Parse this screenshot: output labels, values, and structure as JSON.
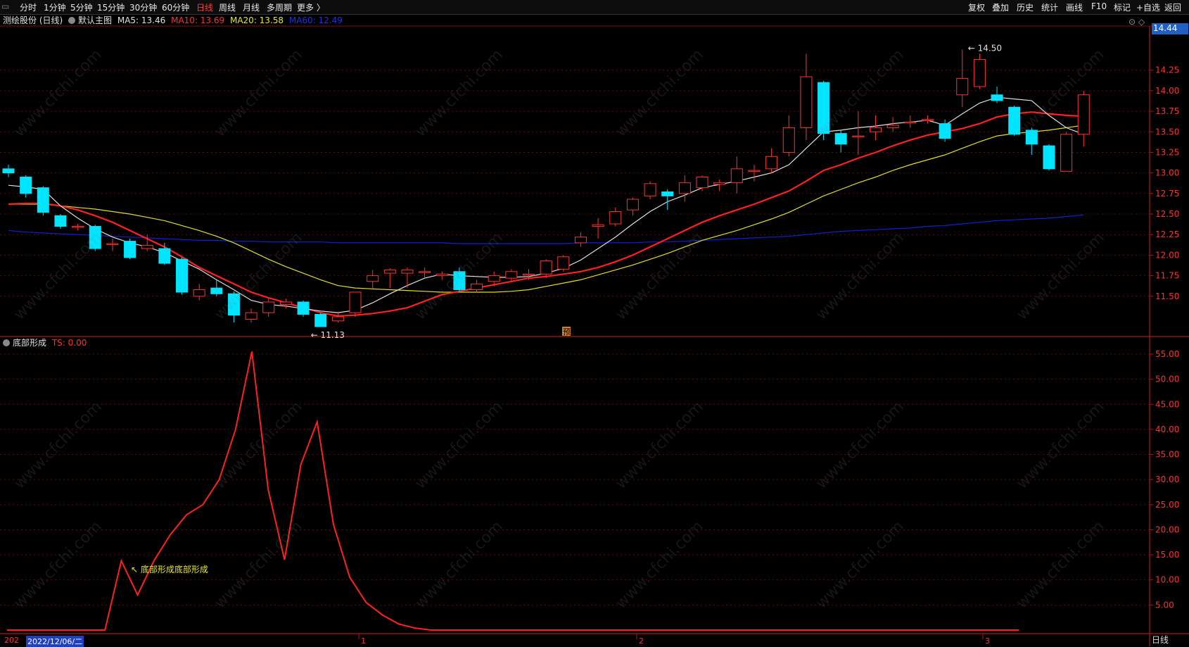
{
  "toolbar": {
    "left_items": [
      "分时",
      "1分钟",
      "5分钟",
      "15分钟",
      "30分钟",
      "60分钟",
      "日线",
      "周线",
      "月线",
      "多周期",
      "更多 〉"
    ],
    "active": "日线",
    "right_items": [
      "复权",
      "叠加",
      "历史",
      "统计",
      "画线",
      "F10",
      "标记",
      "+自选",
      "返回"
    ]
  },
  "info": {
    "stock": "测绘股份 (日线)",
    "template": "默认主图",
    "ma5": "MA5: 13.46",
    "ma10": "MA10: 13.69",
    "ma20": "MA20: 13.58",
    "ma60": "MA60: 12.49"
  },
  "price_axis": {
    "current_tag": "14.44",
    "ticks": [
      "14.25",
      "14.00",
      "13.75",
      "13.50",
      "13.25",
      "13.00",
      "12.75",
      "12.50",
      "12.25",
      "12.00",
      "11.75",
      "11.50"
    ]
  },
  "annotations": {
    "high": "14.50",
    "low": "11.13",
    "forecast": "预",
    "signal": "底部形成底部形成"
  },
  "indicator": {
    "name": "底部形成",
    "value": "TS: 0.00",
    "ticks": [
      "55.00",
      "50.00",
      "45.00",
      "40.00",
      "35.00",
      "30.00",
      "25.00",
      "20.00",
      "15.00",
      "10.00",
      "5.00"
    ]
  },
  "dates": {
    "first": "2022/12/06/二",
    "prefix": "202",
    "month_1": "1",
    "month_2": "2",
    "month_3": "3"
  },
  "period_label": "日线",
  "watermark": "www.cfchi.com",
  "colors": {
    "up": "#ff3232",
    "down": "#00e5ff",
    "ma5": "#e0e0e0",
    "ma10": "#ff2020",
    "ma20": "#e0e020",
    "ma60": "#1020d0"
  },
  "chart_data": [
    {
      "type": "candlestick",
      "title": "测绘股份 (日线)",
      "ylim": [
        11.13,
        14.5
      ],
      "candles": [
        [
          13.05,
          13.0,
          13.1,
          12.95
        ],
        [
          12.95,
          12.75,
          12.97,
          12.7
        ],
        [
          12.82,
          12.52,
          12.84,
          12.48
        ],
        [
          12.48,
          12.35,
          12.5,
          12.32
        ],
        [
          12.35,
          12.35,
          12.38,
          12.3
        ],
        [
          12.35,
          12.08,
          12.37,
          12.05
        ],
        [
          12.14,
          12.14,
          12.2,
          12.05
        ],
        [
          12.17,
          11.97,
          12.2,
          11.95
        ],
        [
          12.08,
          12.12,
          12.25,
          12.05
        ],
        [
          12.08,
          11.9,
          12.15,
          11.88
        ],
        [
          11.95,
          11.55,
          11.97,
          11.52
        ],
        [
          11.5,
          11.58,
          11.65,
          11.45
        ],
        [
          11.6,
          11.53,
          11.7,
          11.5
        ],
        [
          11.53,
          11.27,
          11.56,
          11.18
        ],
        [
          11.22,
          11.3,
          11.35,
          11.18
        ],
        [
          11.3,
          11.43,
          11.47,
          11.25
        ],
        [
          11.4,
          11.43,
          11.47,
          11.35
        ],
        [
          11.43,
          11.28,
          11.45,
          11.25
        ],
        [
          11.28,
          11.13,
          11.3,
          11.13
        ],
        [
          11.2,
          11.25,
          11.3,
          11.18
        ],
        [
          11.3,
          11.55,
          11.55,
          11.25
        ],
        [
          11.68,
          11.75,
          11.82,
          11.6
        ],
        [
          11.78,
          11.82,
          11.84,
          11.6
        ],
        [
          11.78,
          11.82,
          11.85,
          11.6
        ],
        [
          11.8,
          11.8,
          11.85,
          11.72
        ],
        [
          11.75,
          11.77,
          11.8,
          11.7
        ],
        [
          11.8,
          11.58,
          11.85,
          11.55
        ],
        [
          11.58,
          11.65,
          11.7,
          11.55
        ],
        [
          11.68,
          11.75,
          11.8,
          11.62
        ],
        [
          11.72,
          11.8,
          11.83,
          11.68
        ],
        [
          11.77,
          11.77,
          11.83,
          11.7
        ],
        [
          11.77,
          11.93,
          11.95,
          11.72
        ],
        [
          11.83,
          11.98,
          12.0,
          11.8
        ],
        [
          12.15,
          12.22,
          12.28,
          12.1
        ],
        [
          12.35,
          12.37,
          12.45,
          12.2
        ],
        [
          12.38,
          12.53,
          12.58,
          12.35
        ],
        [
          12.55,
          12.68,
          12.7,
          12.48
        ],
        [
          12.72,
          12.87,
          12.9,
          12.68
        ],
        [
          12.77,
          12.72,
          12.8,
          12.55
        ],
        [
          12.75,
          12.88,
          12.97,
          12.65
        ],
        [
          12.82,
          12.95,
          12.97,
          12.78
        ],
        [
          12.86,
          12.88,
          12.92,
          12.78
        ],
        [
          12.88,
          13.05,
          13.2,
          12.75
        ],
        [
          13.03,
          13.03,
          13.1,
          12.9
        ],
        [
          13.05,
          13.2,
          13.3,
          13.0
        ],
        [
          13.25,
          13.55,
          13.7,
          13.2
        ],
        [
          13.55,
          14.17,
          14.45,
          13.4
        ],
        [
          14.1,
          13.48,
          14.12,
          13.4
        ],
        [
          13.48,
          13.35,
          13.52,
          13.25
        ],
        [
          13.45,
          13.45,
          13.75,
          13.22
        ],
        [
          13.5,
          13.55,
          13.7,
          13.4
        ],
        [
          13.55,
          13.58,
          13.68,
          13.5
        ],
        [
          13.62,
          13.62,
          13.7,
          13.55
        ],
        [
          13.65,
          13.65,
          13.7,
          13.6
        ],
        [
          13.6,
          13.42,
          13.65,
          13.38
        ],
        [
          13.95,
          14.15,
          14.5,
          13.8
        ],
        [
          14.05,
          14.38,
          14.45,
          14.02
        ],
        [
          13.95,
          13.88,
          14.05,
          13.85
        ],
        [
          13.8,
          13.47,
          13.82,
          13.45
        ],
        [
          13.52,
          13.35,
          13.55,
          13.22
        ],
        [
          13.33,
          13.05,
          13.35,
          13.03
        ],
        [
          13.02,
          13.47,
          13.5,
          13.02
        ],
        [
          13.47,
          13.95,
          14.0,
          13.32
        ]
      ],
      "ma5": [
        12.85,
        12.83,
        12.8,
        12.6,
        12.45,
        12.32,
        12.22,
        12.15,
        12.1,
        12.03,
        11.93,
        11.83,
        11.7,
        11.58,
        11.45,
        11.4,
        11.38,
        11.35,
        11.32,
        11.3,
        11.33,
        11.42,
        11.53,
        11.63,
        11.72,
        11.77,
        11.75,
        11.74,
        11.73,
        11.73,
        11.74,
        11.78,
        11.84,
        11.94,
        12.08,
        12.22,
        12.38,
        12.53,
        12.65,
        12.73,
        12.82,
        12.86,
        12.9,
        12.95,
        13.0,
        13.1,
        13.3,
        13.5,
        13.52,
        13.55,
        13.57,
        13.6,
        13.62,
        13.64,
        13.58,
        13.72,
        13.85,
        13.92,
        13.9,
        13.88,
        13.7,
        13.55,
        13.47
      ],
      "ma10": [
        12.62,
        12.63,
        12.63,
        12.6,
        12.55,
        12.48,
        12.4,
        12.3,
        12.2,
        12.1,
        11.98,
        11.85,
        11.75,
        11.65,
        11.55,
        11.48,
        11.42,
        11.36,
        11.3,
        11.26,
        11.27,
        11.29,
        11.32,
        11.36,
        11.44,
        11.52,
        11.56,
        11.6,
        11.64,
        11.68,
        11.72,
        11.74,
        11.77,
        11.8,
        11.85,
        11.92,
        12.0,
        12.1,
        12.2,
        12.3,
        12.4,
        12.48,
        12.55,
        12.62,
        12.7,
        12.78,
        12.9,
        13.03,
        13.1,
        13.18,
        13.25,
        13.33,
        13.4,
        13.46,
        13.5,
        13.54,
        13.6,
        13.68,
        13.72,
        13.74,
        13.72,
        13.7,
        13.69
      ],
      "ma20": [
        12.62,
        12.62,
        12.62,
        12.6,
        12.58,
        12.56,
        12.53,
        12.5,
        12.46,
        12.42,
        12.36,
        12.3,
        12.23,
        12.15,
        12.05,
        11.95,
        11.86,
        11.78,
        11.7,
        11.63,
        11.6,
        11.59,
        11.58,
        11.57,
        11.56,
        11.55,
        11.55,
        11.55,
        11.55,
        11.56,
        11.58,
        11.62,
        11.66,
        11.7,
        11.76,
        11.82,
        11.88,
        11.95,
        12.02,
        12.1,
        12.18,
        12.24,
        12.3,
        12.37,
        12.44,
        12.52,
        12.62,
        12.72,
        12.8,
        12.88,
        12.95,
        13.03,
        13.1,
        13.16,
        13.22,
        13.3,
        13.38,
        13.45,
        13.48,
        13.5,
        13.52,
        13.55,
        13.58
      ],
      "ma60": [
        12.3,
        12.28,
        12.27,
        12.26,
        12.25,
        12.24,
        12.23,
        12.22,
        12.21,
        12.2,
        12.19,
        12.18,
        12.18,
        12.17,
        12.17,
        12.16,
        12.16,
        12.16,
        12.16,
        12.15,
        12.15,
        12.15,
        12.15,
        12.15,
        12.15,
        12.15,
        12.14,
        12.14,
        12.14,
        12.14,
        12.14,
        12.14,
        12.14,
        12.15,
        12.15,
        12.15,
        12.15,
        12.16,
        12.16,
        12.17,
        12.18,
        12.19,
        12.2,
        12.21,
        12.22,
        12.23,
        12.25,
        12.27,
        12.29,
        12.3,
        12.31,
        12.32,
        12.33,
        12.35,
        12.36,
        12.38,
        12.4,
        12.42,
        12.43,
        12.44,
        12.45,
        12.47,
        12.49
      ]
    },
    {
      "type": "line",
      "title": "底部形成",
      "ylim": [
        0,
        58
      ],
      "series": [
        {
          "name": "TS",
          "values": [
            0,
            0,
            0,
            0,
            0,
            0,
            0,
            13.8,
            7,
            13.8,
            19,
            23,
            25,
            30,
            40,
            55.5,
            28,
            14,
            33,
            41.5,
            21,
            10.5,
            5.5,
            3,
            1.2,
            0.4,
            0,
            0,
            0,
            0,
            0,
            0,
            0,
            0,
            0,
            0,
            0,
            0,
            0,
            0,
            0,
            0,
            0,
            0,
            0,
            0,
            0,
            0,
            0,
            0,
            0,
            0,
            0,
            0,
            0,
            0,
            0,
            0,
            0,
            0,
            0,
            0,
            0
          ]
        }
      ]
    }
  ]
}
